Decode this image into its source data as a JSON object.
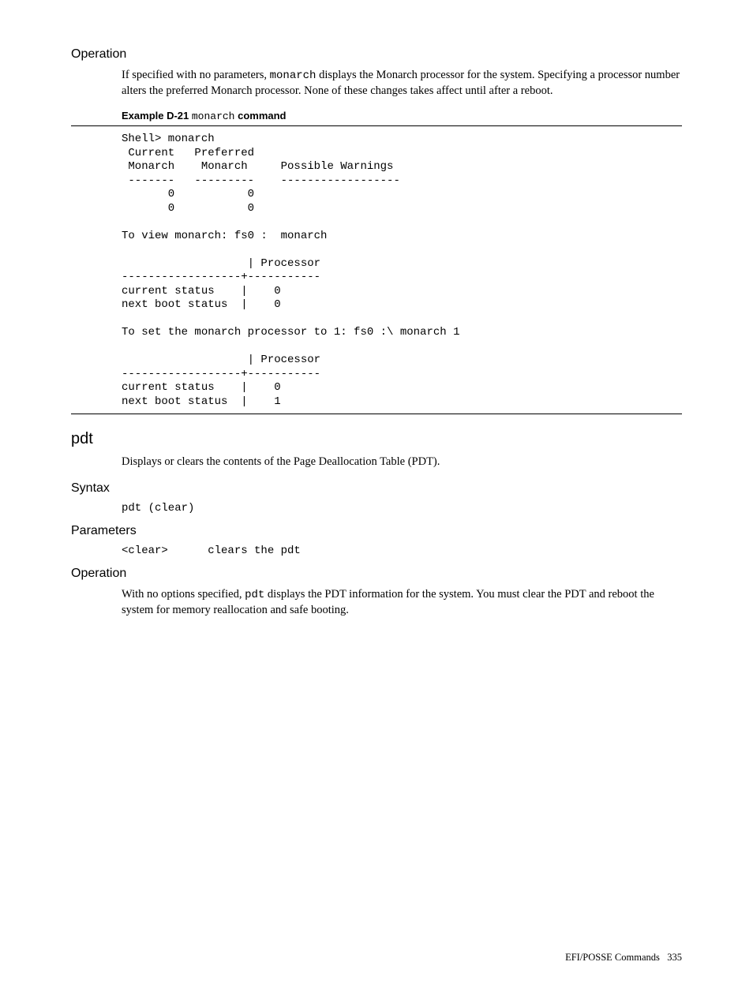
{
  "operation1": {
    "heading": "Operation",
    "text_part1": "If specified with no parameters, ",
    "text_mono1": "monarch",
    "text_part2": " displays the Monarch processor for the system. Specifying a processor number alters the preferred Monarch processor. None of these changes takes affect until after a reboot."
  },
  "example": {
    "label_prefix": "Example D-21 ",
    "label_mono": "monarch",
    "label_suffix": " command",
    "code": "Shell> monarch\n Current   Preferred\n Monarch    Monarch     Possible Warnings\n -------   ---------    ------------------\n       0           0\n       0           0\n\nTo view monarch: fs0 :  monarch\n\n                   | Processor\n------------------+-----------\ncurrent status    |    0\nnext boot status  |    0\n\nTo set the monarch processor to 1: fs0 :\\ monarch 1\n\n                   | Processor\n------------------+-----------\ncurrent status    |    0\nnext boot status  |    1"
  },
  "pdt": {
    "heading": "pdt",
    "description": "Displays or clears the contents of the Page Deallocation Table (PDT)."
  },
  "syntax": {
    "heading": "Syntax",
    "code": "pdt (clear)"
  },
  "parameters": {
    "heading": "Parameters",
    "code": "<clear>      clears the pdt"
  },
  "operation2": {
    "heading": "Operation",
    "text_part1": "With no options specified, ",
    "text_mono1": "pdt",
    "text_part2": " displays the PDT information for the system. You must clear the PDT and reboot the system for memory reallocation and safe booting."
  },
  "footer": {
    "text": "EFI/POSSE Commands",
    "page": "335"
  }
}
